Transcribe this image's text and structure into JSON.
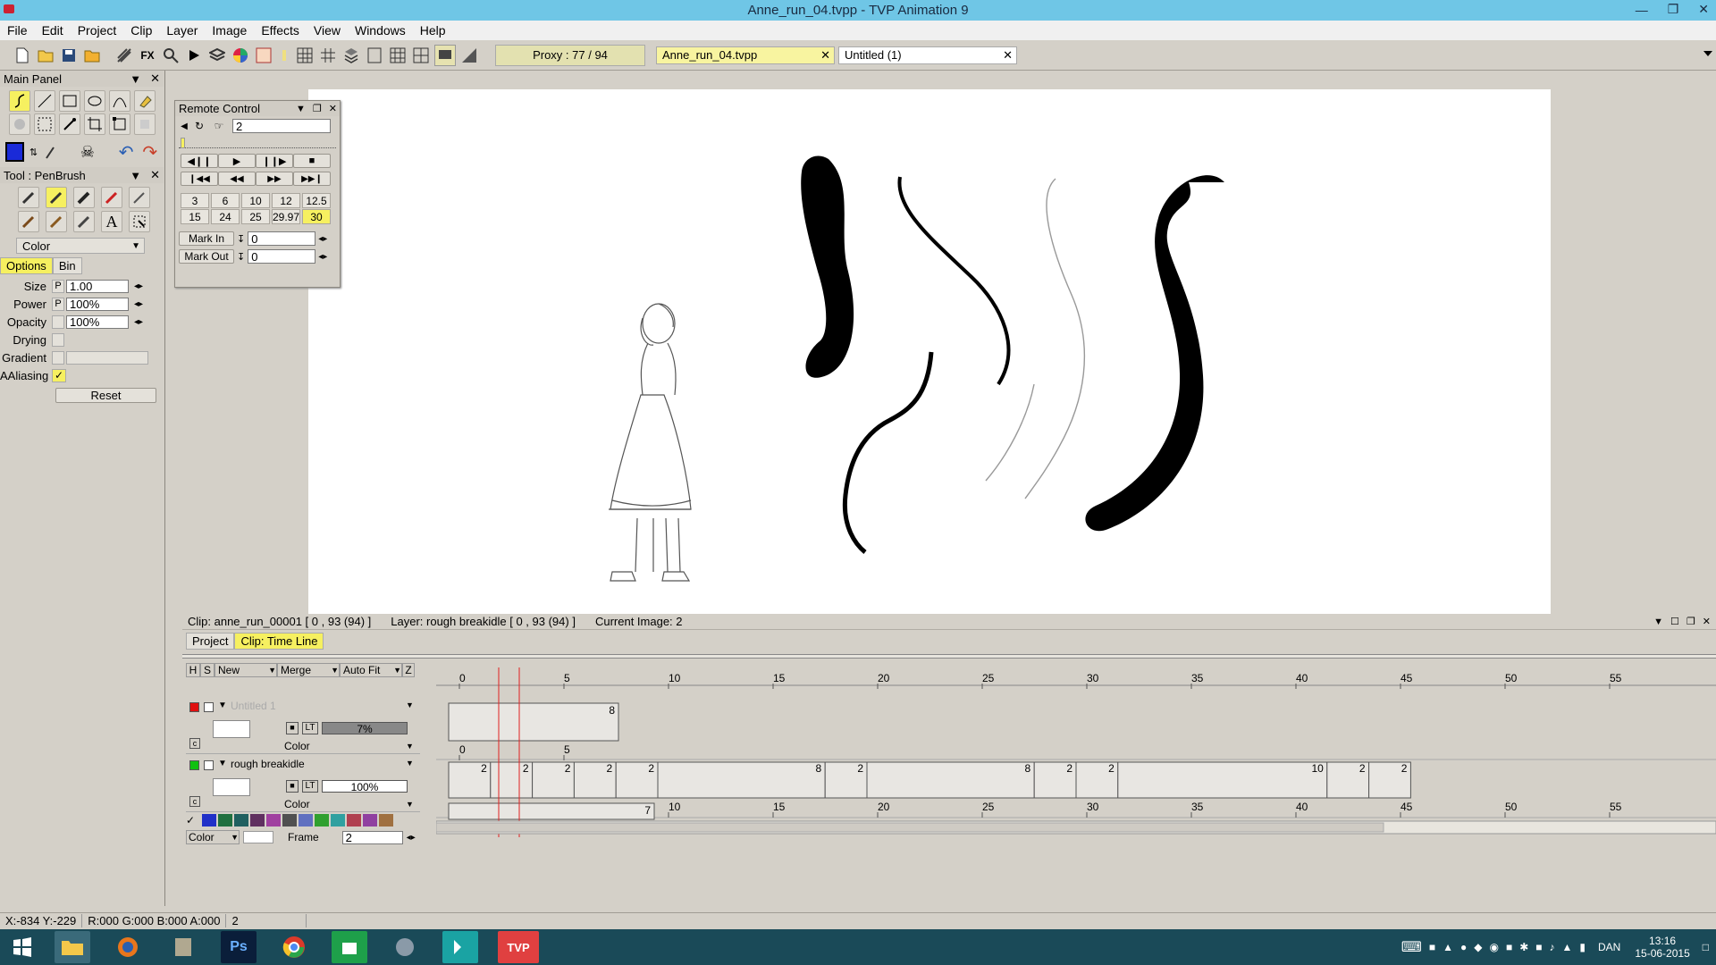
{
  "window": {
    "title": "Anne_run_04.tvpp - TVP Animation 9"
  },
  "menu": [
    "File",
    "Edit",
    "Project",
    "Clip",
    "Layer",
    "Image",
    "Effects",
    "View",
    "Windows",
    "Help"
  ],
  "toolbar": {
    "proxy": "Proxy : 77 / 94",
    "tabs": [
      "Anne_run_04.tvpp",
      "Untitled (1)"
    ]
  },
  "main_panel": {
    "title": "Main Panel"
  },
  "tool_panel": {
    "title": "Tool : PenBrush",
    "mode": "Color",
    "tabs": [
      "Options",
      "Bin"
    ],
    "options": [
      {
        "label": "Size",
        "flag": "P",
        "value": "1.00"
      },
      {
        "label": "Power",
        "flag": "P",
        "value": "100%"
      },
      {
        "label": "Opacity",
        "flag": "",
        "value": "100%"
      },
      {
        "label": "Drying",
        "flag": "",
        "value": ""
      },
      {
        "label": "Gradient",
        "flag": "",
        "value": ""
      },
      {
        "label": "AAliasing",
        "flag": "",
        "value": ""
      }
    ],
    "reset": "Reset"
  },
  "remote": {
    "title": "Remote Control",
    "frame_value": "2",
    "fps_row1": [
      "3",
      "6",
      "10",
      "12",
      "12.5"
    ],
    "fps_row2": [
      "15",
      "24",
      "25",
      "29.97",
      "30"
    ],
    "mark_in_label": "Mark In",
    "mark_in_value": "0",
    "mark_out_label": "Mark Out",
    "mark_out_value": "0"
  },
  "timeline": {
    "info": {
      "clip": "Clip: anne_run_00001 [ 0 , 93  (94) ]",
      "layer": "Layer: rough breakidle [ 0 , 93  (94) ]",
      "current": "Current Image: 2"
    },
    "tabs": [
      "Project",
      "Clip: Time Line"
    ],
    "header": {
      "h": "H",
      "s": "S",
      "new": "New",
      "merge": "Merge",
      "autofit": "Auto Fit",
      "z": "Z"
    },
    "ruler": [
      "0",
      "5",
      "10",
      "15",
      "20",
      "25",
      "30",
      "35",
      "40",
      "45",
      "50",
      "55"
    ],
    "layers": [
      {
        "name": "Untitled 1",
        "opacity": "7%",
        "blend": "Color",
        "lt": "LT",
        "end": "8"
      },
      {
        "name": "rough breakidle",
        "opacity": "100%",
        "blend": "Color",
        "lt": "LT"
      }
    ],
    "color_label": "Color",
    "frame_label": "Frame",
    "frame_value": "2",
    "third_end": "7",
    "rb_marks": [
      "2",
      "2",
      "2",
      "2",
      "2",
      "8",
      "2",
      "8",
      "2",
      "2",
      "10",
      "2",
      "2"
    ]
  },
  "status": {
    "coords": "X:-834  Y:-229",
    "rgba": "R:000 G:000 B:000 A:000",
    "frame": "2"
  },
  "taskbar": {
    "lang": "DAN",
    "time": "13:16",
    "date": "15-06-2015"
  }
}
